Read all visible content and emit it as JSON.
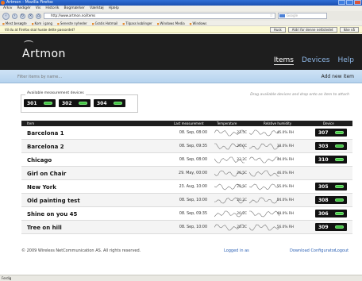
{
  "browser": {
    "window_title": "Artmon - Mozilla Firefox",
    "menu": [
      "Arkiv",
      "Redigér",
      "Vis",
      "Historik",
      "Bogmærker",
      "Værktøj",
      "Hjælp"
    ],
    "url": "http://www.artmon.no/items",
    "search_placeholder": "Google",
    "bookmarks": [
      "Mest besøgte",
      "Kom i gang",
      "Seneste nyheder",
      "Gratis Hotmail",
      "Tilpass koblinger",
      "Windows Media",
      "Windows"
    ],
    "notification": "Vil du at Firefox skal huske dette passordet?",
    "notification_buttons": [
      "Husk",
      "Aldri for denne nettstedet",
      "Ikke nå"
    ],
    "status": "Ferdig"
  },
  "app": {
    "logo": "Artmon",
    "nav": [
      "Items",
      "Devices",
      "Help"
    ],
    "filter_placeholder": "Filter items by name...",
    "add_new": "Add new item"
  },
  "available": {
    "title": "Available measurement devices",
    "devices": [
      "301",
      "302",
      "304"
    ],
    "hint": "Drag available devices and drop onto an item to attach"
  },
  "table": {
    "headers": [
      "Item",
      "Last measurement",
      "Temperature",
      "Relative humidity",
      "Device"
    ],
    "rows": [
      {
        "name": "Barcelona 1",
        "date": "08. Sep, 08:00",
        "temp": "23.5C",
        "hum": "45.0% RH",
        "device": "307"
      },
      {
        "name": "Barcelona 2",
        "date": "08. Sep, 09:35",
        "temp": "26.0C",
        "hum": "38.0% RH",
        "device": "303"
      },
      {
        "name": "Chicago",
        "date": "08. Sep, 08:00",
        "temp": "23.2C",
        "hum": "44.0% RH",
        "device": "310"
      },
      {
        "name": "Girl on Chair",
        "date": "29. May, 00:00",
        "temp": "20.5C",
        "hum": "46.0% RH",
        "device": ""
      },
      {
        "name": "New York",
        "date": "23. Aug, 10:00",
        "temp": "20.5C",
        "hum": "55.0% RH",
        "device": "305"
      },
      {
        "name": "Old painting test",
        "date": "08. Sep, 10:00",
        "temp": "20.2C",
        "hum": "54.0% RH",
        "device": "308"
      },
      {
        "name": "Shine on you 45",
        "date": "08. Sep, 09:35",
        "temp": "20.2C",
        "hum": "48.0% RH",
        "device": "306"
      },
      {
        "name": "Tree on hill",
        "date": "08. Sep, 10:00",
        "temp": "20.2C",
        "hum": "56.0% RH",
        "device": "309"
      }
    ]
  },
  "footer": {
    "copyright": "© 2009 Wireless NetCommunication AS. All rights reserved.",
    "logged_in": "Logged in as",
    "download": "Download Configurator",
    "logout": "Logout"
  },
  "colors": {
    "header_bg": "#1e1e1e",
    "filter_bg": "#cfe3f5",
    "nav_link": "#8eb7e6",
    "led_green": "#3fc43f"
  }
}
